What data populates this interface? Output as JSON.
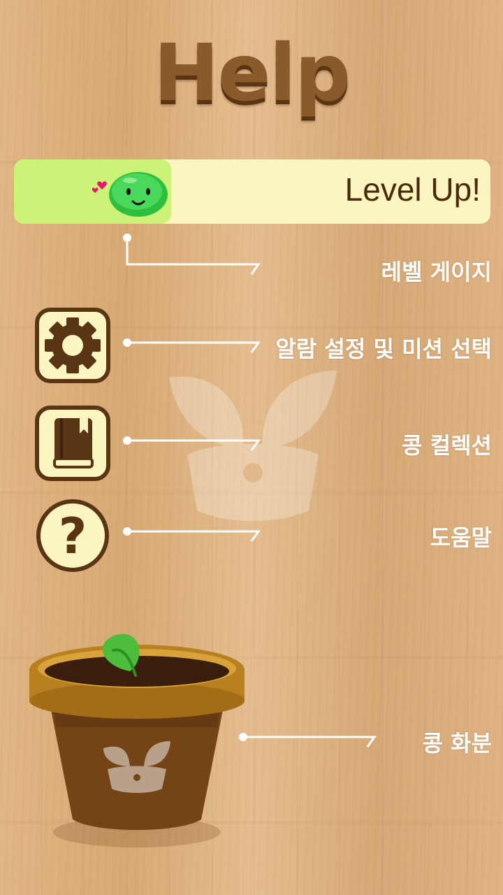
{
  "page": {
    "title": "Help"
  },
  "level_gauge": {
    "button_text": "Level Up!",
    "progress": 0.33
  },
  "settings_button": {
    "icon": "gear-icon"
  },
  "collection_button": {
    "icon": "book-icon"
  },
  "help_button": {
    "symbol": "?"
  },
  "labels": {
    "level_gauge": "레벨 게이지",
    "alarm_mission": "알람 설정 및 미션 선택",
    "bean_collection": "콩 컬렉션",
    "help": "도움말",
    "bean_pot": "콩 화분"
  },
  "colors": {
    "title": "#8a5a2b",
    "title_shadow": "#5a3514",
    "bar_bg": "#fbf5c2",
    "bar_fill": "#ccf277",
    "bean": "#3cd24a",
    "icon_border": "#5a3514",
    "label": "#ffffff"
  }
}
